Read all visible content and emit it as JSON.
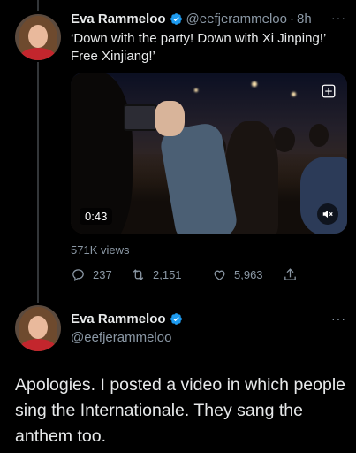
{
  "tweet1": {
    "author_name": "Eva Rammeloo",
    "handle": "@eefjerammeloo",
    "separator": "·",
    "time": "8h",
    "text": "‘Down with the party! Down with Xi Jinping!’ Free Xinjiang!’",
    "video_time": "0:43",
    "views": "571K views",
    "replies": "237",
    "retweets": "2,151",
    "likes": "5,963"
  },
  "tweet2": {
    "author_name": "Eva Rammeloo",
    "handle": "@eefjerammeloo",
    "text": "Apologies. I posted a video in which people sing the Internationale. They sang the anthem too."
  },
  "colors": {
    "background": "#000000",
    "verified": "#1d9bf0",
    "secondary_text": "#8b98a5",
    "primary_text": "#e7e9ea"
  }
}
